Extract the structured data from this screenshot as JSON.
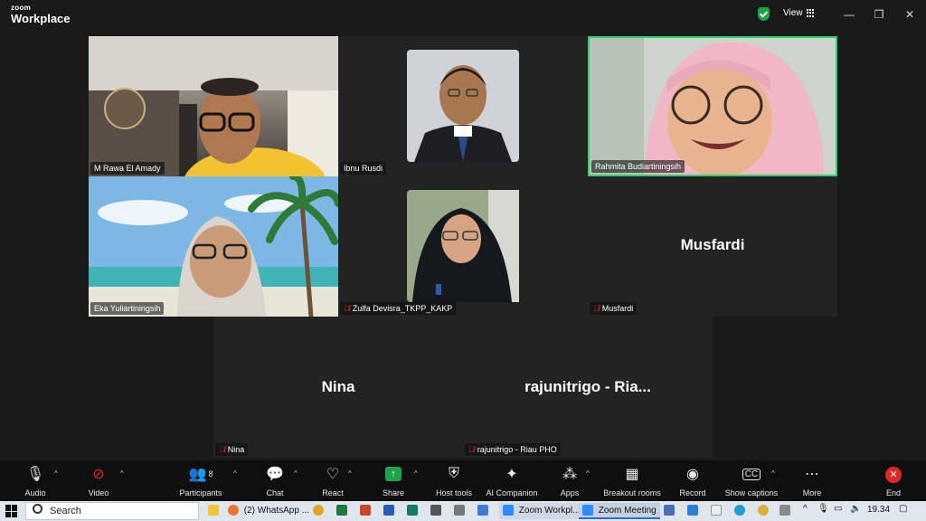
{
  "app": {
    "brand_line1": "zoom",
    "brand_line2": "Workplace"
  },
  "titlebar": {
    "view_label": "View",
    "minimize": "—",
    "restore": "❐",
    "close": "✕"
  },
  "colors": {
    "active_speaker_border": "#2fd36b",
    "tile_dark": "#232323",
    "end_red": "#e02828",
    "share_green": "#1aa34a"
  },
  "participants": [
    {
      "name": "M Rawa El Amady",
      "muted": false,
      "video": true
    },
    {
      "name": "Ibnu Rusdi",
      "muted": false,
      "video": true
    },
    {
      "name": "Rahmita Budiartiningsih",
      "muted": false,
      "video": true,
      "active_speaker": true
    },
    {
      "name": "Eka Yuliartiningsih",
      "muted": false,
      "video": true
    },
    {
      "name": "Zulfa Devisra_TKPP_KAKP",
      "muted": true,
      "video": true
    },
    {
      "name": "Musfardi",
      "display": "Musfardi",
      "muted": true,
      "video": false
    },
    {
      "name": "Nina",
      "display": "Nina",
      "muted": true,
      "video": false
    },
    {
      "name": "rajunitrigo - Riau PHO",
      "display": "rajunitrigo - Ria...",
      "muted": true,
      "video": false
    }
  ],
  "toolbar": {
    "audio": "Audio",
    "video": "Video",
    "participants": "Participants",
    "participants_count": "8",
    "chat": "Chat",
    "react": "React",
    "share": "Share",
    "host_tools": "Host tools",
    "ai_companion": "AI Companion",
    "apps": "Apps",
    "breakout": "Breakout rooms",
    "record": "Record",
    "captions": "Show captions",
    "more": "More",
    "end": "End"
  },
  "taskbar": {
    "search_placeholder": "Search",
    "whatsapp": "(2) WhatsApp ...",
    "zoom_workplace": "Zoom Workpl...",
    "zoom_meeting": "Zoom Meeting",
    "time": "19.34"
  }
}
